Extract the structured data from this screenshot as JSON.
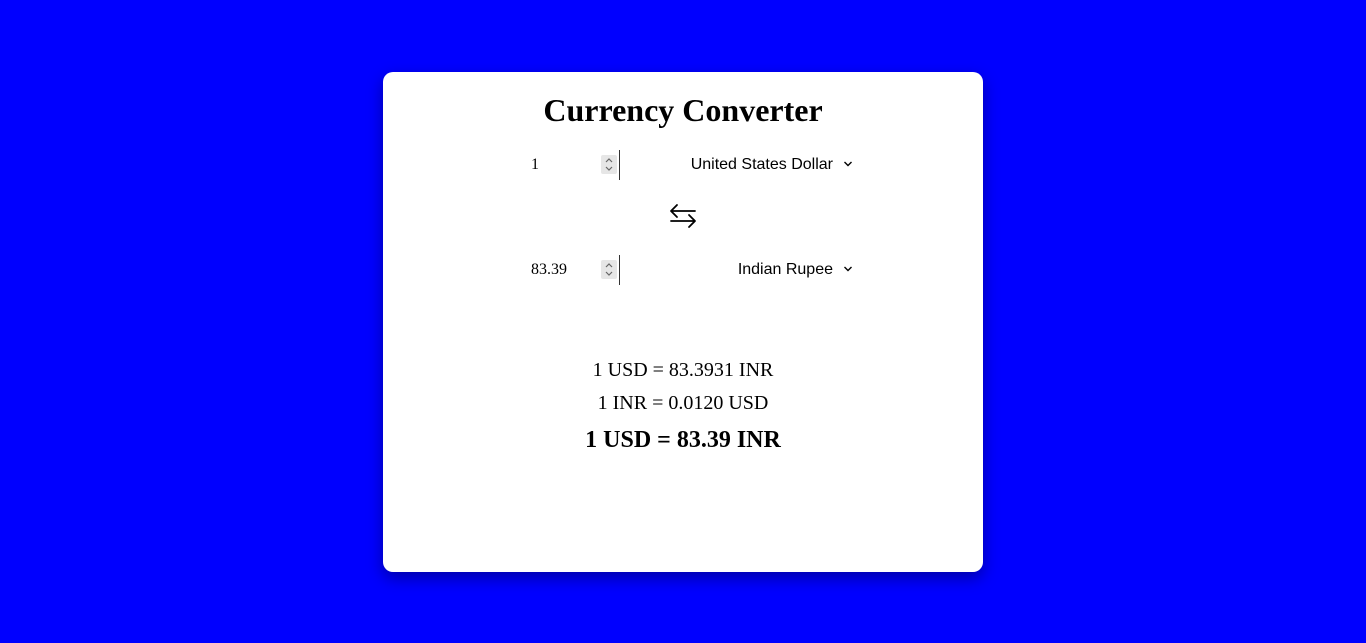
{
  "app": {
    "title": "Currency Converter"
  },
  "from": {
    "amount": "1",
    "currency": "United States Dollar"
  },
  "to": {
    "amount": "83.39",
    "currency": "Indian Rupee"
  },
  "rates": {
    "forward": "1 USD = 83.3931 INR",
    "reverse": "1 INR = 0.0120 USD",
    "result": "1 USD = 83.39 INR"
  },
  "colors": {
    "background": "#0000ff",
    "card": "#ffffff"
  },
  "icons": {
    "swap": "swap-arrows-icon",
    "spinner": "spinner-icon",
    "dropdown": "chevron-down-icon"
  }
}
